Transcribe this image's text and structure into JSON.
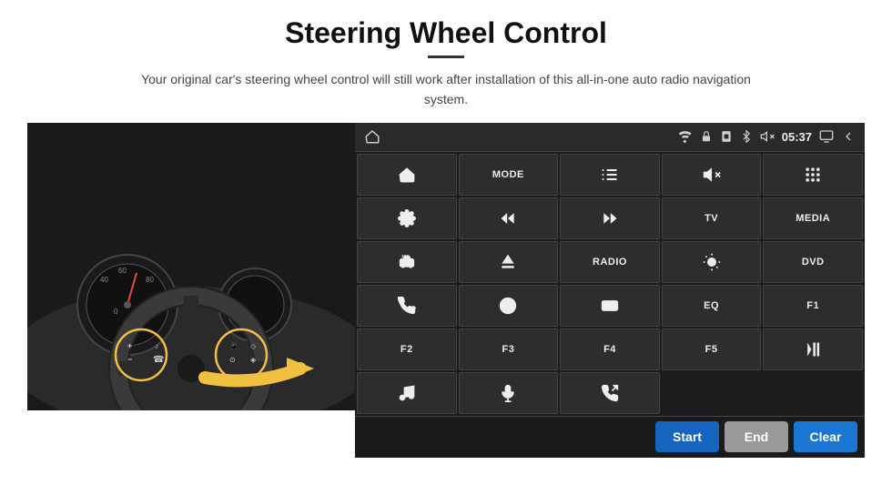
{
  "header": {
    "title": "Steering Wheel Control",
    "divider": true,
    "subtitle": "Your original car's steering wheel control will still work after installation of this all-in-one auto radio navigation system."
  },
  "status_bar": {
    "time": "05:37",
    "icons": [
      "wifi",
      "lock",
      "sim",
      "bluetooth",
      "volume",
      "screen",
      "back"
    ]
  },
  "button_grid": [
    {
      "row": 1,
      "cells": [
        {
          "type": "icon",
          "icon": "home",
          "label": ""
        },
        {
          "type": "text",
          "label": "MODE"
        },
        {
          "type": "icon",
          "icon": "list",
          "label": ""
        },
        {
          "type": "icon",
          "icon": "mute",
          "label": ""
        },
        {
          "type": "icon",
          "icon": "apps",
          "label": ""
        }
      ]
    },
    {
      "row": 2,
      "cells": [
        {
          "type": "icon",
          "icon": "settings-circle",
          "label": ""
        },
        {
          "type": "icon",
          "icon": "prev",
          "label": ""
        },
        {
          "type": "icon",
          "icon": "next",
          "label": ""
        },
        {
          "type": "text",
          "label": "TV"
        },
        {
          "type": "text",
          "label": "MEDIA"
        }
      ]
    },
    {
      "row": 3,
      "cells": [
        {
          "type": "icon",
          "icon": "360-car",
          "label": ""
        },
        {
          "type": "icon",
          "icon": "eject",
          "label": ""
        },
        {
          "type": "text",
          "label": "RADIO"
        },
        {
          "type": "icon",
          "icon": "brightness",
          "label": ""
        },
        {
          "type": "text",
          "label": "DVD"
        }
      ]
    },
    {
      "row": 4,
      "cells": [
        {
          "type": "icon",
          "icon": "phone",
          "label": ""
        },
        {
          "type": "icon",
          "icon": "navigation",
          "label": ""
        },
        {
          "type": "icon",
          "icon": "screen-mirror",
          "label": ""
        },
        {
          "type": "text",
          "label": "EQ"
        },
        {
          "type": "text",
          "label": "F1"
        }
      ]
    },
    {
      "row": 5,
      "cells": [
        {
          "type": "text",
          "label": "F2"
        },
        {
          "type": "text",
          "label": "F3"
        },
        {
          "type": "text",
          "label": "F4"
        },
        {
          "type": "text",
          "label": "F5"
        },
        {
          "type": "icon",
          "icon": "play-pause",
          "label": ""
        }
      ]
    },
    {
      "row": 6,
      "cells": [
        {
          "type": "icon",
          "icon": "music",
          "label": ""
        },
        {
          "type": "icon",
          "icon": "mic",
          "label": ""
        },
        {
          "type": "icon",
          "icon": "phone-answer",
          "label": ""
        },
        {
          "type": "empty",
          "label": ""
        },
        {
          "type": "empty",
          "label": ""
        }
      ]
    }
  ],
  "bottom_bar": {
    "start_label": "Start",
    "end_label": "End",
    "clear_label": "Clear"
  }
}
